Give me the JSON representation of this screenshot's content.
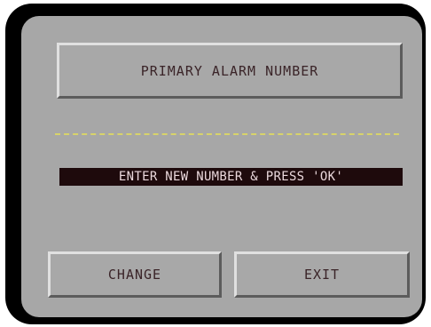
{
  "screen": {
    "title": "PRIMARY ALARM NUMBER",
    "prompt": "ENTER NEW NUMBER & PRESS 'OK'"
  },
  "buttons": {
    "change_label": "CHANGE",
    "exit_label": "EXIT"
  },
  "colors": {
    "bezel": "#000000",
    "screen_background": "#a7a7a7",
    "separator": "#d8d36a",
    "prompt_background": "#1e0a0c",
    "prompt_text": "#ead8dc",
    "button_text": "#3a2428"
  }
}
